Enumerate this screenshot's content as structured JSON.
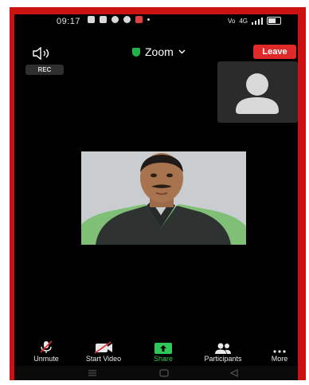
{
  "status_bar": {
    "time": "09:17",
    "right_text": "Vo",
    "network": "4G"
  },
  "header": {
    "title": "Zoom",
    "leave_label": "Leave",
    "rec_label": "REC"
  },
  "toolbar": {
    "items": [
      {
        "label": "Unmute",
        "icon": "microphone-muted-icon"
      },
      {
        "label": "Start Video",
        "icon": "video-off-icon"
      },
      {
        "label": "Share",
        "icon": "share-icon"
      },
      {
        "label": "Participants",
        "icon": "participants-icon"
      },
      {
        "label": "More",
        "icon": "more-icon"
      }
    ]
  },
  "colors": {
    "frame_border": "#cc1111",
    "leave_button": "#e02a2a",
    "share_accent": "#2fc65a",
    "shield": "#22b14c"
  }
}
